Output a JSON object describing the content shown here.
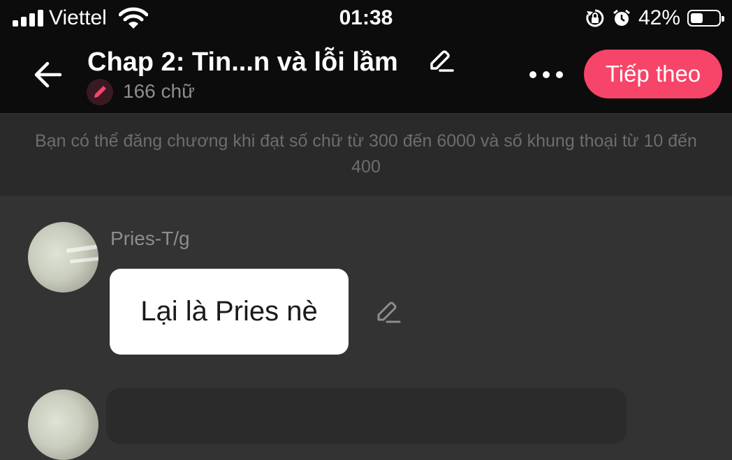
{
  "status_bar": {
    "carrier": "Viettel",
    "time": "01:38",
    "battery": "42%",
    "battery_level": 0.42
  },
  "header": {
    "title": "Chap 2: Tin...n và lỗi lầm",
    "word_count": "166 chữ",
    "next_label": "Tiếp theo"
  },
  "notice": {
    "text": "Bạn có thể đăng chương khi đạt số chữ từ 300 đến 6000 và số khung thoại từ 10 đến 400"
  },
  "messages": [
    {
      "sender": "Pries-T/g",
      "text": "Lại là Pries nè"
    }
  ],
  "colors": {
    "accent": "#f74469",
    "header_bg": "#0c0c0c",
    "body_bg": "#333333",
    "notice_bg": "#2a2a2a"
  },
  "icons": [
    "back-arrow-icon",
    "edit-pencil-icon",
    "pen-badge-icon",
    "more-icon",
    "wifi-icon",
    "signal-icon",
    "rotation-lock-icon",
    "alarm-icon",
    "battery-icon"
  ]
}
